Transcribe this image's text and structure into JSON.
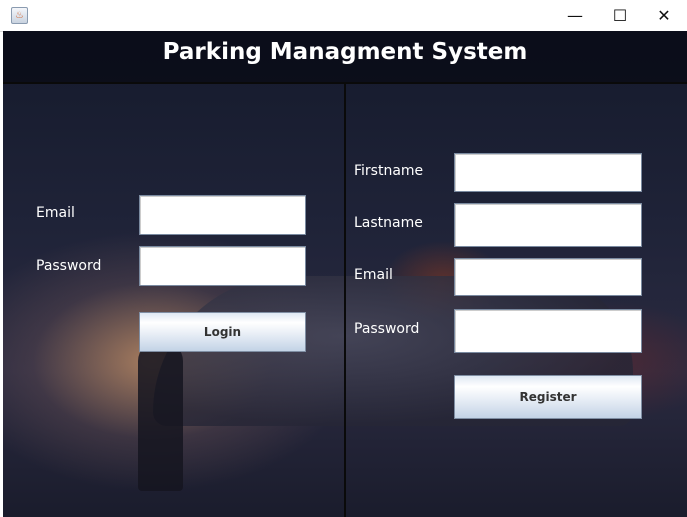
{
  "window": {
    "app_icon": "java-icon",
    "minimize": "—",
    "maximize": "☐",
    "close": "✕"
  },
  "header": {
    "title": "Parking Managment System"
  },
  "login": {
    "email_label": "Email",
    "email_value": "",
    "password_label": "Password",
    "password_value": "",
    "button": "Login"
  },
  "register": {
    "firstname_label": "Firstname",
    "firstname_value": "",
    "lastname_label": "Lastname",
    "lastname_value": "",
    "email_label": "Email",
    "email_value": "",
    "password_label": "Password",
    "password_value": "",
    "button": "Register"
  }
}
